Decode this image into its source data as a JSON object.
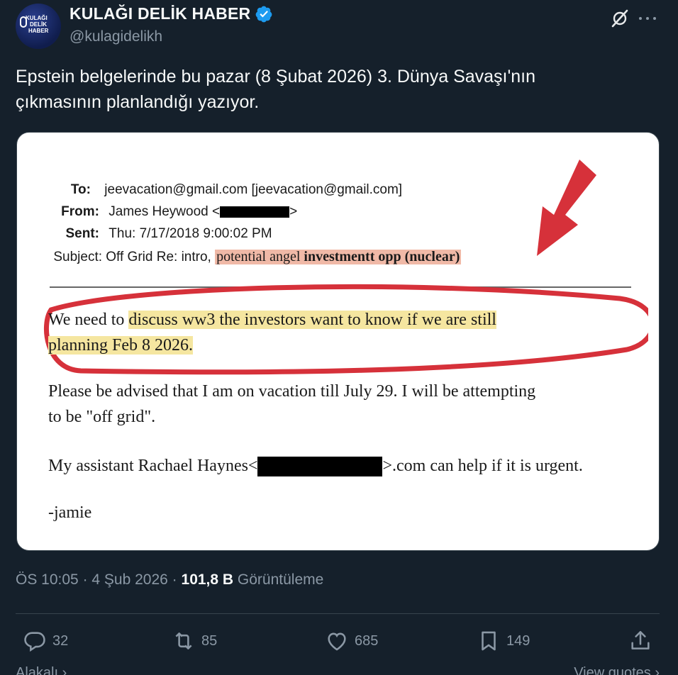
{
  "author": {
    "display_name": "KULAĞI DELİK HABER",
    "handle": "@kulagidelikh",
    "avatar_text": [
      "KULAĞI",
      "DELİK",
      "HABER"
    ]
  },
  "tweet": {
    "text_line1": "Epstein belgelerinde bu pazar (8 Şubat 2026) 3. Dünya Savaşı'nın",
    "text_line2": "çıkmasının planlandığı yazıyor."
  },
  "media": {
    "to_label": "To:",
    "to_value": "jeevacation@gmail.com [jeevacation@gmail.com]",
    "from_label": "From:",
    "from_value": "James Heywood <",
    "from_suffix": ">",
    "sent_label": "Sent:",
    "sent_value": "Thu: 7/17/2018 9:00:02 PM",
    "subject_label": "Subject:",
    "subject_plain": "Off Grid Re: intro, ",
    "subject_highlight_a": "potential angel ",
    "subject_highlight_b": "investmentt opp (nuclear)",
    "body1_prefix": "We need to ",
    "body1_highlight": "discuss ww3 the investors want to know if we are still",
    "body2": "planning Feb 8 2026.",
    "body3": "Please be advised that I am on vacation till July 29. I will be attempting",
    "body4": "to be \"off grid\".",
    "body5_prefix": "My assistant Rachael Haynes<",
    "body5_suffix": ">.com can help if it is urgent.",
    "signature": "-jamie"
  },
  "meta": {
    "time": "ÖS 10:05",
    "separator1": " · ",
    "date": "4 Şub 2026",
    "separator2": " · ",
    "views_count": "101,8 B",
    "views_label": " Görüntüleme"
  },
  "actions": {
    "replies": "32",
    "reposts": "85",
    "likes": "685",
    "bookmarks": "149"
  },
  "footer": {
    "left_label": "Alakalı",
    "right_label": "View quotes"
  },
  "colors": {
    "background": "#15202b",
    "verified_badge": "#1d9bf0",
    "annotation_red": "#d6313a",
    "highlight_yellow": "#f5e6a0",
    "highlight_salmon": "#f0b9a7"
  },
  "icons": [
    "verified-badge-icon",
    "grok-icon",
    "more-icon",
    "reply-icon",
    "repost-icon",
    "like-icon",
    "bookmark-icon",
    "share-icon",
    "arrow-annotation-icon"
  ]
}
